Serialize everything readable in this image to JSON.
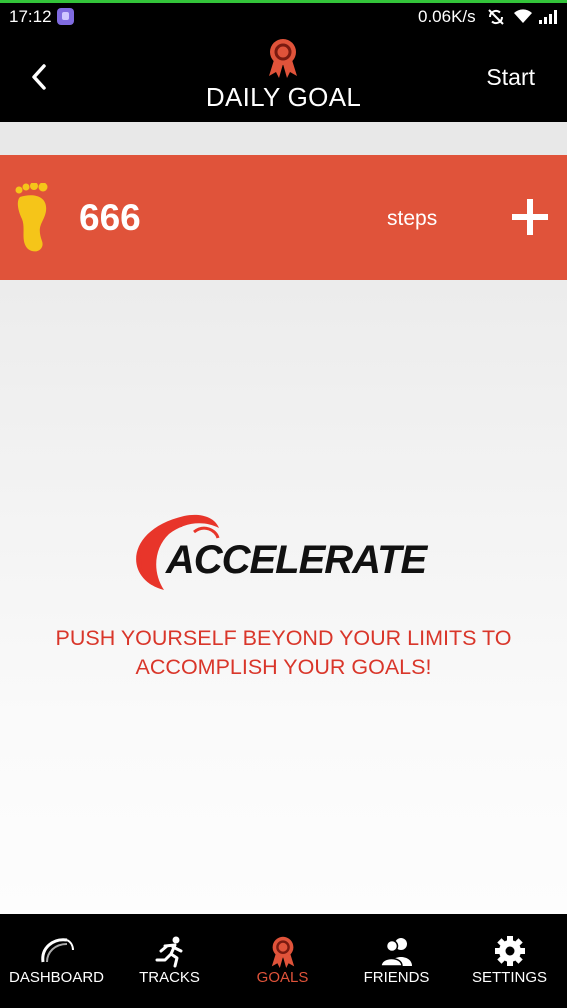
{
  "status_bar": {
    "time": "17:12",
    "network_speed": "0.06K/s",
    "icons": [
      "app-notification-icon",
      "no-sync-icon",
      "wifi-icon",
      "signal-icon"
    ]
  },
  "header": {
    "title": "DAILY GOAL",
    "start_label": "Start",
    "icons": [
      "back-icon",
      "ribbon-award-icon"
    ]
  },
  "goal": {
    "value": "666",
    "unit": "steps",
    "icons": [
      "foot-icon",
      "plus-icon"
    ]
  },
  "brand": {
    "logo_text": "ACCELERATE",
    "tagline_line1": "PUSH YOURSELF BEYOND YOUR LIMITS TO",
    "tagline_line2": "ACCOMPLISH YOUR GOALS!"
  },
  "nav": {
    "items": [
      {
        "label": "DASHBOARD",
        "icon": "speedometer-icon",
        "active": false
      },
      {
        "label": "TRACKS",
        "icon": "runner-icon",
        "active": false
      },
      {
        "label": "GOALS",
        "icon": "ribbon-award-icon",
        "active": true
      },
      {
        "label": "FRIENDS",
        "icon": "friends-icon",
        "active": false
      },
      {
        "label": "SETTINGS",
        "icon": "gear-icon",
        "active": false
      }
    ]
  },
  "colors": {
    "accent": "#e0533a",
    "tagline": "#d9362a",
    "foot": "#f5c519",
    "bars": "#000000"
  }
}
